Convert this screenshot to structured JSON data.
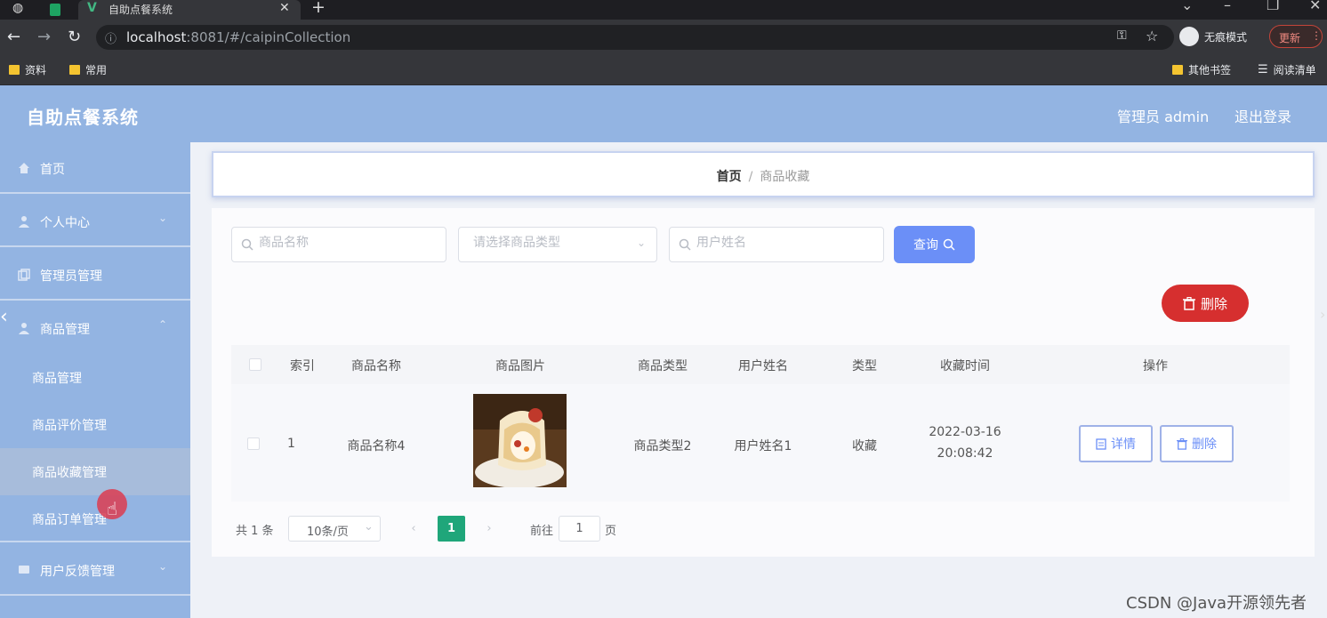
{
  "browser": {
    "tab_title": "自助点餐系统",
    "url_host": "localhost",
    "url_rest": ":8081/#/caipinCollection",
    "incognito_label": "无痕模式",
    "update_label": "更新",
    "bookmarks": [
      "资料",
      "常用"
    ],
    "other_bookmarks": "其他书签",
    "reading_list": "阅读清单"
  },
  "header": {
    "title": "自助点餐系统",
    "admin": "管理员 admin",
    "logout": "退出登录"
  },
  "sidebar": {
    "items": [
      {
        "label": "首页"
      },
      {
        "label": "个人中心"
      },
      {
        "label": "管理员管理"
      },
      {
        "label": "商品管理"
      }
    ],
    "sub_items": [
      {
        "label": "商品管理"
      },
      {
        "label": "商品评价管理"
      },
      {
        "label": "商品收藏管理"
      },
      {
        "label": "商品订单管理"
      }
    ],
    "after_items": [
      {
        "label": "用户反馈管理"
      }
    ]
  },
  "breadcrumb": {
    "home": "首页",
    "separator": "/",
    "current": "商品收藏"
  },
  "search": {
    "name_placeholder": "商品名称",
    "type_placeholder": "请选择商品类型",
    "user_placeholder": "用户姓名",
    "query_label": "查询"
  },
  "actions": {
    "delete_label": "删除"
  },
  "table": {
    "headers": [
      "索引",
      "商品名称",
      "商品图片",
      "商品类型",
      "用户姓名",
      "类型",
      "收藏时间",
      "操作"
    ],
    "rows": [
      {
        "index": "1",
        "name": "商品名称4",
        "type": "商品类型2",
        "user": "用户姓名1",
        "kind": "收藏",
        "date": "2022-03-16",
        "time": "20:08:42",
        "detail_label": "详情",
        "delete_label": "删除"
      }
    ]
  },
  "pagination": {
    "total": "共 1 条",
    "page_size": "10条/页",
    "current_page": "1",
    "goto_label": "前往",
    "goto_value": "1",
    "page_unit": "页"
  },
  "watermark": "CSDN @Java开源领先者",
  "colors": {
    "header": "#93b4e2",
    "primary": "#6b8ff7",
    "danger": "#d62f2f",
    "page_active": "#1fa67a"
  }
}
